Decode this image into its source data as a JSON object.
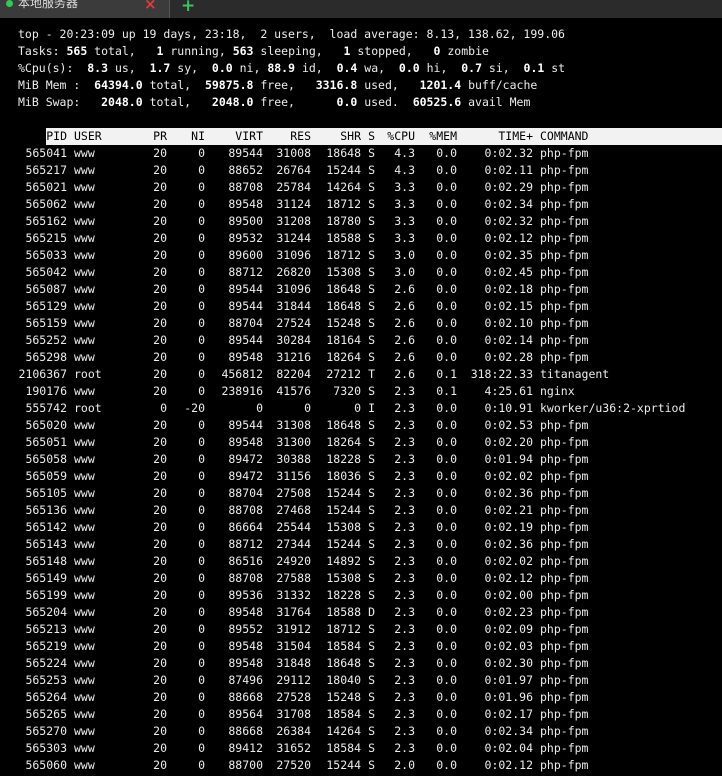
{
  "tab": {
    "title": "本地服务器",
    "close": "×",
    "add": "+"
  },
  "summary": {
    "uptime": "top - 20:23:09 up 19 days, 23:18,  2 users,  load average: 8.13, 138.62, 199.06",
    "tasks": [
      "Tasks: ",
      "565",
      " total,   ",
      "1",
      " running, ",
      "563",
      " sleeping,   ",
      "1",
      " stopped,   ",
      "0",
      " zombie"
    ],
    "cpu": [
      "%Cpu(s):  ",
      "8.3",
      " us,  ",
      "1.7",
      " sy,  ",
      "0.0",
      " ni, ",
      "88.9",
      " id,  ",
      "0.4",
      " wa,  ",
      "0.0",
      " hi,  ",
      "0.7",
      " si,  ",
      "0.1",
      " st"
    ],
    "mem": [
      "MiB Mem :  ",
      "64394.0",
      " total,  ",
      "59875.8",
      " free,   ",
      "3316.8",
      " used,   ",
      "1201.4",
      " buff/cache"
    ],
    "swap": [
      "MiB Swap:   ",
      "2048.0",
      " total,   ",
      "2048.0",
      " free,      ",
      "0.0",
      " used.  ",
      "60525.6",
      " avail Mem"
    ]
  },
  "columns": [
    "PID",
    "USER",
    "PR",
    "NI",
    "VIRT",
    "RES",
    "SHR",
    "S",
    "%CPU",
    "%MEM",
    "TIME+",
    "COMMAND"
  ],
  "processes": [
    [
      "565041",
      "www",
      "20",
      "0",
      "89544",
      "31008",
      "18648",
      "S",
      "4.3",
      "0.0",
      "0:02.32",
      "php-fpm"
    ],
    [
      "565217",
      "www",
      "20",
      "0",
      "88652",
      "26764",
      "15244",
      "S",
      "4.3",
      "0.0",
      "0:02.11",
      "php-fpm"
    ],
    [
      "565021",
      "www",
      "20",
      "0",
      "88708",
      "25784",
      "14264",
      "S",
      "3.3",
      "0.0",
      "0:02.29",
      "php-fpm"
    ],
    [
      "565062",
      "www",
      "20",
      "0",
      "89548",
      "31124",
      "18712",
      "S",
      "3.3",
      "0.0",
      "0:02.34",
      "php-fpm"
    ],
    [
      "565162",
      "www",
      "20",
      "0",
      "89500",
      "31208",
      "18780",
      "S",
      "3.3",
      "0.0",
      "0:02.32",
      "php-fpm"
    ],
    [
      "565215",
      "www",
      "20",
      "0",
      "89532",
      "31244",
      "18588",
      "S",
      "3.3",
      "0.0",
      "0:02.12",
      "php-fpm"
    ],
    [
      "565033",
      "www",
      "20",
      "0",
      "89600",
      "31096",
      "18712",
      "S",
      "3.0",
      "0.0",
      "0:02.35",
      "php-fpm"
    ],
    [
      "565042",
      "www",
      "20",
      "0",
      "88712",
      "26820",
      "15308",
      "S",
      "3.0",
      "0.0",
      "0:02.45",
      "php-fpm"
    ],
    [
      "565087",
      "www",
      "20",
      "0",
      "89544",
      "31096",
      "18648",
      "S",
      "2.6",
      "0.0",
      "0:02.18",
      "php-fpm"
    ],
    [
      "565129",
      "www",
      "20",
      "0",
      "89544",
      "31844",
      "18648",
      "S",
      "2.6",
      "0.0",
      "0:02.15",
      "php-fpm"
    ],
    [
      "565159",
      "www",
      "20",
      "0",
      "88704",
      "27524",
      "15248",
      "S",
      "2.6",
      "0.0",
      "0:02.10",
      "php-fpm"
    ],
    [
      "565252",
      "www",
      "20",
      "0",
      "89544",
      "30284",
      "18164",
      "S",
      "2.6",
      "0.0",
      "0:02.14",
      "php-fpm"
    ],
    [
      "565298",
      "www",
      "20",
      "0",
      "89548",
      "31216",
      "18264",
      "S",
      "2.6",
      "0.0",
      "0:02.28",
      "php-fpm"
    ],
    [
      "2106367",
      "root",
      "20",
      "0",
      "456812",
      "82204",
      "27212",
      "T",
      "2.6",
      "0.1",
      "318:22.33",
      "titanagent"
    ],
    [
      "190176",
      "www",
      "20",
      "0",
      "238916",
      "41576",
      "7320",
      "S",
      "2.3",
      "0.1",
      "4:25.61",
      "nginx"
    ],
    [
      "555742",
      "root",
      "0",
      "-20",
      "0",
      "0",
      "0",
      "I",
      "2.3",
      "0.0",
      "0:10.91",
      "kworker/u36:2-xprtiod"
    ],
    [
      "565020",
      "www",
      "20",
      "0",
      "89544",
      "31308",
      "18648",
      "S",
      "2.3",
      "0.0",
      "0:02.53",
      "php-fpm"
    ],
    [
      "565051",
      "www",
      "20",
      "0",
      "89548",
      "31300",
      "18264",
      "S",
      "2.3",
      "0.0",
      "0:02.20",
      "php-fpm"
    ],
    [
      "565058",
      "www",
      "20",
      "0",
      "89472",
      "30388",
      "18228",
      "S",
      "2.3",
      "0.0",
      "0:01.94",
      "php-fpm"
    ],
    [
      "565059",
      "www",
      "20",
      "0",
      "89472",
      "31156",
      "18036",
      "S",
      "2.3",
      "0.0",
      "0:02.02",
      "php-fpm"
    ],
    [
      "565105",
      "www",
      "20",
      "0",
      "88704",
      "27508",
      "15244",
      "S",
      "2.3",
      "0.0",
      "0:02.36",
      "php-fpm"
    ],
    [
      "565136",
      "www",
      "20",
      "0",
      "88708",
      "27468",
      "15244",
      "S",
      "2.3",
      "0.0",
      "0:02.21",
      "php-fpm"
    ],
    [
      "565142",
      "www",
      "20",
      "0",
      "86664",
      "25544",
      "15308",
      "S",
      "2.3",
      "0.0",
      "0:02.19",
      "php-fpm"
    ],
    [
      "565143",
      "www",
      "20",
      "0",
      "88712",
      "27344",
      "15244",
      "S",
      "2.3",
      "0.0",
      "0:02.36",
      "php-fpm"
    ],
    [
      "565148",
      "www",
      "20",
      "0",
      "86516",
      "24920",
      "14892",
      "S",
      "2.3",
      "0.0",
      "0:02.02",
      "php-fpm"
    ],
    [
      "565149",
      "www",
      "20",
      "0",
      "88708",
      "27588",
      "15308",
      "S",
      "2.3",
      "0.0",
      "0:02.12",
      "php-fpm"
    ],
    [
      "565199",
      "www",
      "20",
      "0",
      "89536",
      "31332",
      "18228",
      "S",
      "2.3",
      "0.0",
      "0:02.00",
      "php-fpm"
    ],
    [
      "565204",
      "www",
      "20",
      "0",
      "89548",
      "31764",
      "18588",
      "D",
      "2.3",
      "0.0",
      "0:02.23",
      "php-fpm"
    ],
    [
      "565213",
      "www",
      "20",
      "0",
      "89552",
      "31912",
      "18712",
      "S",
      "2.3",
      "0.0",
      "0:02.09",
      "php-fpm"
    ],
    [
      "565219",
      "www",
      "20",
      "0",
      "89548",
      "31504",
      "18584",
      "S",
      "2.3",
      "0.0",
      "0:02.03",
      "php-fpm"
    ],
    [
      "565224",
      "www",
      "20",
      "0",
      "89548",
      "31848",
      "18648",
      "S",
      "2.3",
      "0.0",
      "0:02.30",
      "php-fpm"
    ],
    [
      "565253",
      "www",
      "20",
      "0",
      "87496",
      "29112",
      "18040",
      "S",
      "2.3",
      "0.0",
      "0:01.97",
      "php-fpm"
    ],
    [
      "565264",
      "www",
      "20",
      "0",
      "88668",
      "27528",
      "15248",
      "S",
      "2.3",
      "0.0",
      "0:01.96",
      "php-fpm"
    ],
    [
      "565265",
      "www",
      "20",
      "0",
      "89564",
      "31708",
      "18584",
      "S",
      "2.3",
      "0.0",
      "0:02.17",
      "php-fpm"
    ],
    [
      "565270",
      "www",
      "20",
      "0",
      "88668",
      "26384",
      "14264",
      "S",
      "2.3",
      "0.0",
      "0:02.34",
      "php-fpm"
    ],
    [
      "565303",
      "www",
      "20",
      "0",
      "89412",
      "31652",
      "18584",
      "S",
      "2.3",
      "0.0",
      "0:02.04",
      "php-fpm"
    ],
    [
      "565060",
      "www",
      "20",
      "0",
      "88700",
      "27520",
      "15244",
      "S",
      "2.0",
      "0.0",
      "0:02.12",
      "php-fpm"
    ]
  ]
}
